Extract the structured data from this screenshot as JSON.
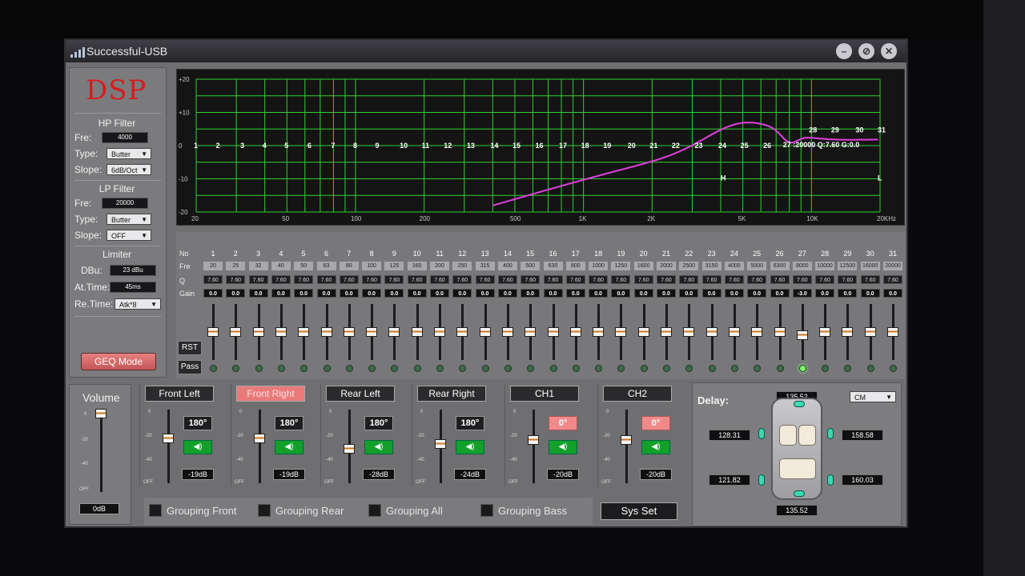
{
  "window": {
    "title": "Successful-USB"
  },
  "left_panel": {
    "logo": "DSP",
    "hp_filter": {
      "title": "HP Filter",
      "fre_label": "Fre:",
      "fre": "4000",
      "type_label": "Type:",
      "type": "Butter",
      "slope_label": "Slope:",
      "slope": "6dB/Oct"
    },
    "lp_filter": {
      "title": "LP Filter",
      "fre_label": "Fre:",
      "fre": "20000",
      "type_label": "Type:",
      "type": "Butter",
      "slope_label": "Slope:",
      "slope": "OFF"
    },
    "limiter": {
      "title": "Limiter",
      "dbu_label": "DBu:",
      "dbu": "23 dBu",
      "attime_label": "At.Time:",
      "attime": "45ms",
      "retime_label": "Re.Time:",
      "retime": "Atk*8"
    },
    "geq_mode": "GEQ Mode"
  },
  "graph": {
    "y_ticks": [
      "+20",
      "+10",
      "0",
      "-10",
      "-20"
    ],
    "x_ticks": [
      "20",
      "50",
      "100",
      "200",
      "500",
      "1K",
      "2K",
      "5K",
      "10K",
      "20KHz"
    ],
    "point_labels": [
      "1",
      "2",
      "3",
      "4",
      "5",
      "6",
      "7",
      "8",
      "9",
      "10",
      "11",
      "12",
      "13",
      "14",
      "15",
      "16",
      "17",
      "18",
      "19",
      "20",
      "21",
      "22",
      "23",
      "24",
      "25",
      "26",
      "28",
      "29",
      "30",
      "31"
    ],
    "point_27_label": "27 :20000 Q:7.60 G:0.0",
    "h_marker": "H",
    "l_marker": "L",
    "curve_color": "#e03fe0",
    "grid_color": "#2fd12f"
  },
  "eq": {
    "row_labels": {
      "no": "No",
      "fre": "Fre",
      "q": "Q",
      "gain": "Gain"
    },
    "bands": [
      {
        "no": "1",
        "fre": "20",
        "q": "7.60",
        "gain": "0.0",
        "level": 0
      },
      {
        "no": "2",
        "fre": "25",
        "q": "7.60",
        "gain": "0.0",
        "level": 0
      },
      {
        "no": "3",
        "fre": "32",
        "q": "7.60",
        "gain": "0.0",
        "level": 0
      },
      {
        "no": "4",
        "fre": "40",
        "q": "7.60",
        "gain": "0.0",
        "level": 0
      },
      {
        "no": "5",
        "fre": "50",
        "q": "7.60",
        "gain": "0.0",
        "level": 0
      },
      {
        "no": "6",
        "fre": "63",
        "q": "7.60",
        "gain": "0.0",
        "level": 0
      },
      {
        "no": "7",
        "fre": "80",
        "q": "7.60",
        "gain": "0.0",
        "level": 0
      },
      {
        "no": "8",
        "fre": "100",
        "q": "7.60",
        "gain": "0.0",
        "level": 0
      },
      {
        "no": "9",
        "fre": "125",
        "q": "7.60",
        "gain": "0.0",
        "level": 0
      },
      {
        "no": "10",
        "fre": "160",
        "q": "7.60",
        "gain": "0.0",
        "level": 0
      },
      {
        "no": "11",
        "fre": "200",
        "q": "7.60",
        "gain": "0.0",
        "level": 0
      },
      {
        "no": "12",
        "fre": "250",
        "q": "7.60",
        "gain": "0.0",
        "level": 0
      },
      {
        "no": "13",
        "fre": "315",
        "q": "7.60",
        "gain": "0.0",
        "level": 0
      },
      {
        "no": "14",
        "fre": "400",
        "q": "7.60",
        "gain": "0.0",
        "level": 0
      },
      {
        "no": "15",
        "fre": "500",
        "q": "7.60",
        "gain": "0.0",
        "level": 0
      },
      {
        "no": "16",
        "fre": "630",
        "q": "7.60",
        "gain": "0.0",
        "level": 0
      },
      {
        "no": "17",
        "fre": "800",
        "q": "7.60",
        "gain": "0.0",
        "level": 0
      },
      {
        "no": "18",
        "fre": "1000",
        "q": "7.60",
        "gain": "0.0",
        "level": 0
      },
      {
        "no": "19",
        "fre": "1250",
        "q": "7.60",
        "gain": "0.0",
        "level": 0
      },
      {
        "no": "20",
        "fre": "1600",
        "q": "7.60",
        "gain": "0.0",
        "level": 0
      },
      {
        "no": "21",
        "fre": "2000",
        "q": "7.60",
        "gain": "0.0",
        "level": 0
      },
      {
        "no": "22",
        "fre": "2500",
        "q": "7.60",
        "gain": "0.0",
        "level": 0
      },
      {
        "no": "23",
        "fre": "3150",
        "q": "7.60",
        "gain": "0.0",
        "level": 0
      },
      {
        "no": "24",
        "fre": "4000",
        "q": "7.60",
        "gain": "0.0",
        "level": 0
      },
      {
        "no": "25",
        "fre": "5000",
        "q": "7.60",
        "gain": "0.0",
        "level": 0
      },
      {
        "no": "26",
        "fre": "6300",
        "q": "7.60",
        "gain": "0.0",
        "level": 0
      },
      {
        "no": "27",
        "fre": "8000",
        "q": "7.60",
        "gain": "-3.0",
        "level": -3
      },
      {
        "no": "28",
        "fre": "10000",
        "q": "7.60",
        "gain": "0.0",
        "level": 0
      },
      {
        "no": "29",
        "fre": "12500",
        "q": "7.60",
        "gain": "0.0",
        "level": 0
      },
      {
        "no": "30",
        "fre": "16000",
        "q": "7.60",
        "gain": "0.0",
        "level": 0
      },
      {
        "no": "31",
        "fre": "20000",
        "q": "7.60",
        "gain": "0.0",
        "level": 0
      }
    ],
    "rst": "RST",
    "pass": "Pass",
    "active_led": 27
  },
  "volume": {
    "title": "Volume",
    "value": "0dB",
    "scale": [
      "0",
      "-20",
      "-40",
      "OFF"
    ]
  },
  "channels": [
    {
      "name": "Front Left",
      "phase": "180°",
      "level": "-19dB",
      "active": false
    },
    {
      "name": "Front Right",
      "phase": "180°",
      "level": "-19dB",
      "active": true
    },
    {
      "name": "Rear Left",
      "phase": "180°",
      "level": "-28dB",
      "active": false
    },
    {
      "name": "Rear Right",
      "phase": "180°",
      "level": "-24dB",
      "active": false
    },
    {
      "name": "CH1",
      "phase": "0°",
      "level": "-20dB",
      "active": false
    },
    {
      "name": "CH2",
      "phase": "0°",
      "level": "-20dB",
      "active": false
    }
  ],
  "channel_scale": [
    "0",
    "-20",
    "-40",
    "OFF"
  ],
  "grouping": {
    "front": "Grouping Front",
    "rear": "Grouping Rear",
    "all": "Grouping All",
    "bass": "Grouping Bass"
  },
  "sys_set": "Sys Set",
  "delay": {
    "title": "Delay:",
    "unit": "CM",
    "top": "135.52",
    "front_left": "128.31",
    "front_right": "158.58",
    "rear_left": "121.82",
    "rear_right": "160.03",
    "bottom": "135.52"
  }
}
